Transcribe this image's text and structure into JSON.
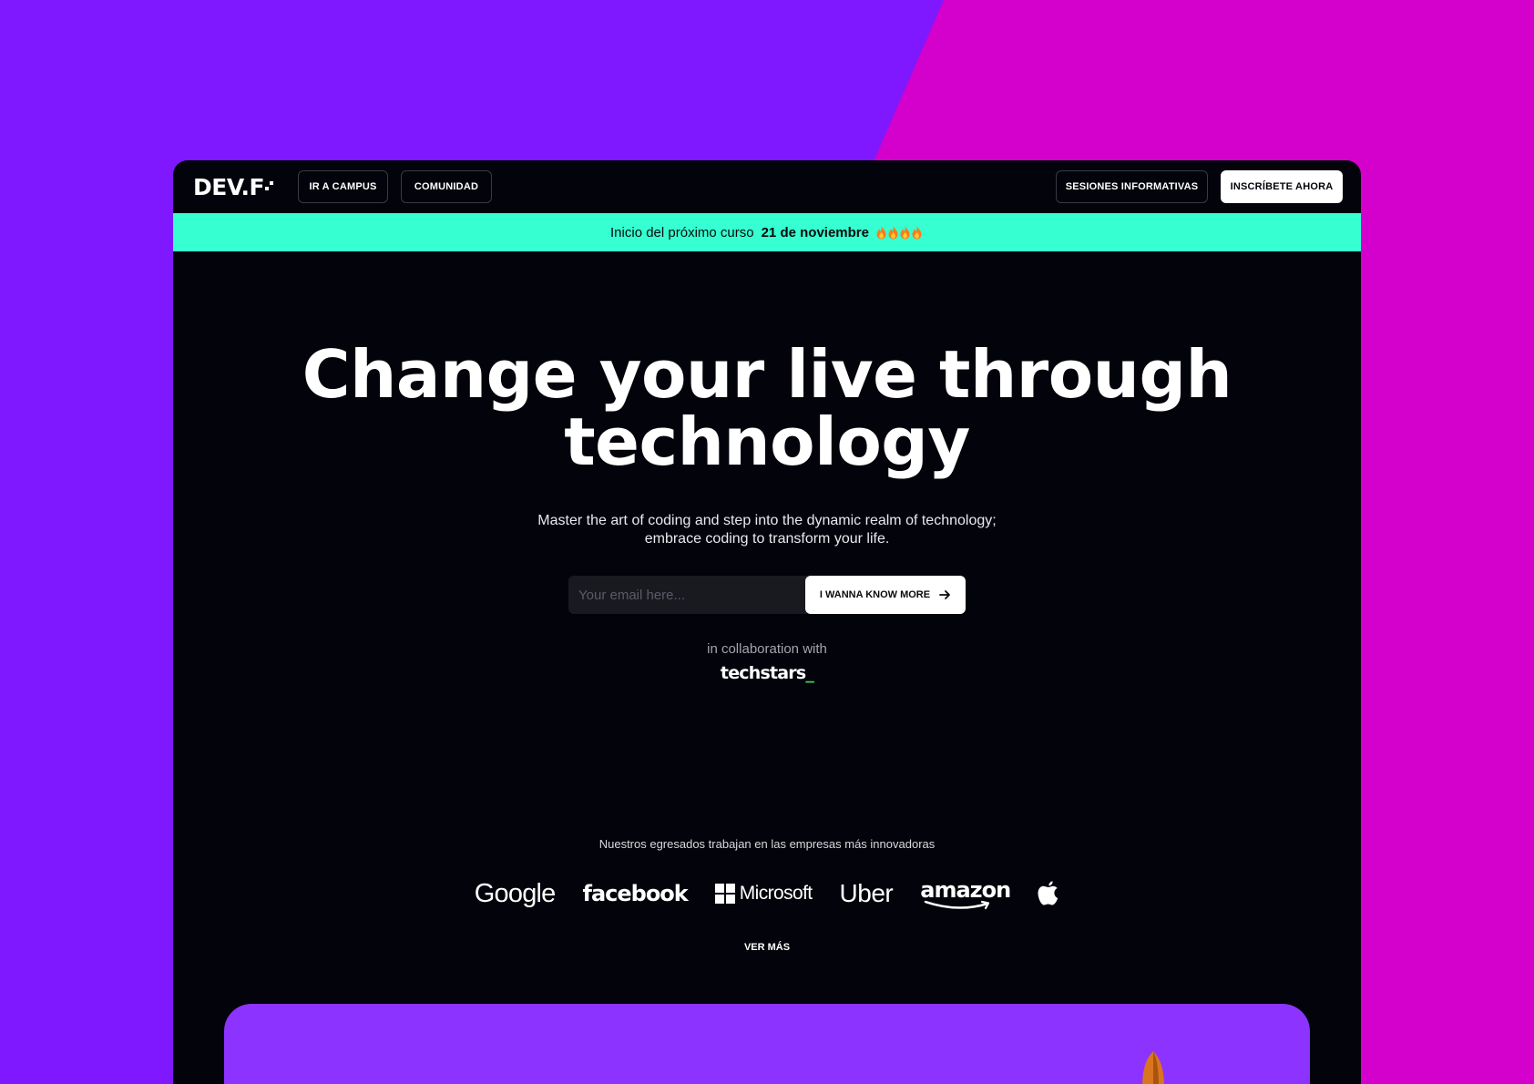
{
  "colors": {
    "background_left": "#7f17ff",
    "background_right": "#d400cc",
    "window_bg": "#03030b",
    "announce_bg": "#36ffd2",
    "card_bg": "#8c33ff",
    "techstars_accent": "#39d353"
  },
  "nav": {
    "logo": "DEV.F",
    "campus_label": "IR A CAMPUS",
    "comunidad_label": "COMUNIDAD",
    "sesiones_label": "SESIONES INFORMATIVAS",
    "inscribete_label": "INSCRÍBETE AHORA"
  },
  "announcement": {
    "text": "Inicio del próximo curso",
    "date": "21 de noviembre",
    "icons": [
      "fire-icon",
      "fire-icon",
      "fire-icon",
      "fire-icon"
    ]
  },
  "hero": {
    "title_line1": "Change your live through",
    "title_line2": "technology",
    "subtitle_line1": "Master the art of coding and step into the dynamic realm of technology;",
    "subtitle_line2": "embrace coding to transform your life.",
    "email_placeholder": "Your email here...",
    "cta_label": "I WANNA KNOW MORE",
    "cta_icon": "arrow-right-icon",
    "collab_text": "in collaboration with",
    "collab_brand": "techstars",
    "collab_brand_suffix": "_"
  },
  "companies": {
    "heading": "Nuestros egresados trabajan en las empresas más innovadoras",
    "logos": [
      "Google",
      "facebook",
      "Microsoft",
      "Uber",
      "amazon"
    ],
    "apple_icon": "apple-icon",
    "more_label": "VER MÁS"
  }
}
